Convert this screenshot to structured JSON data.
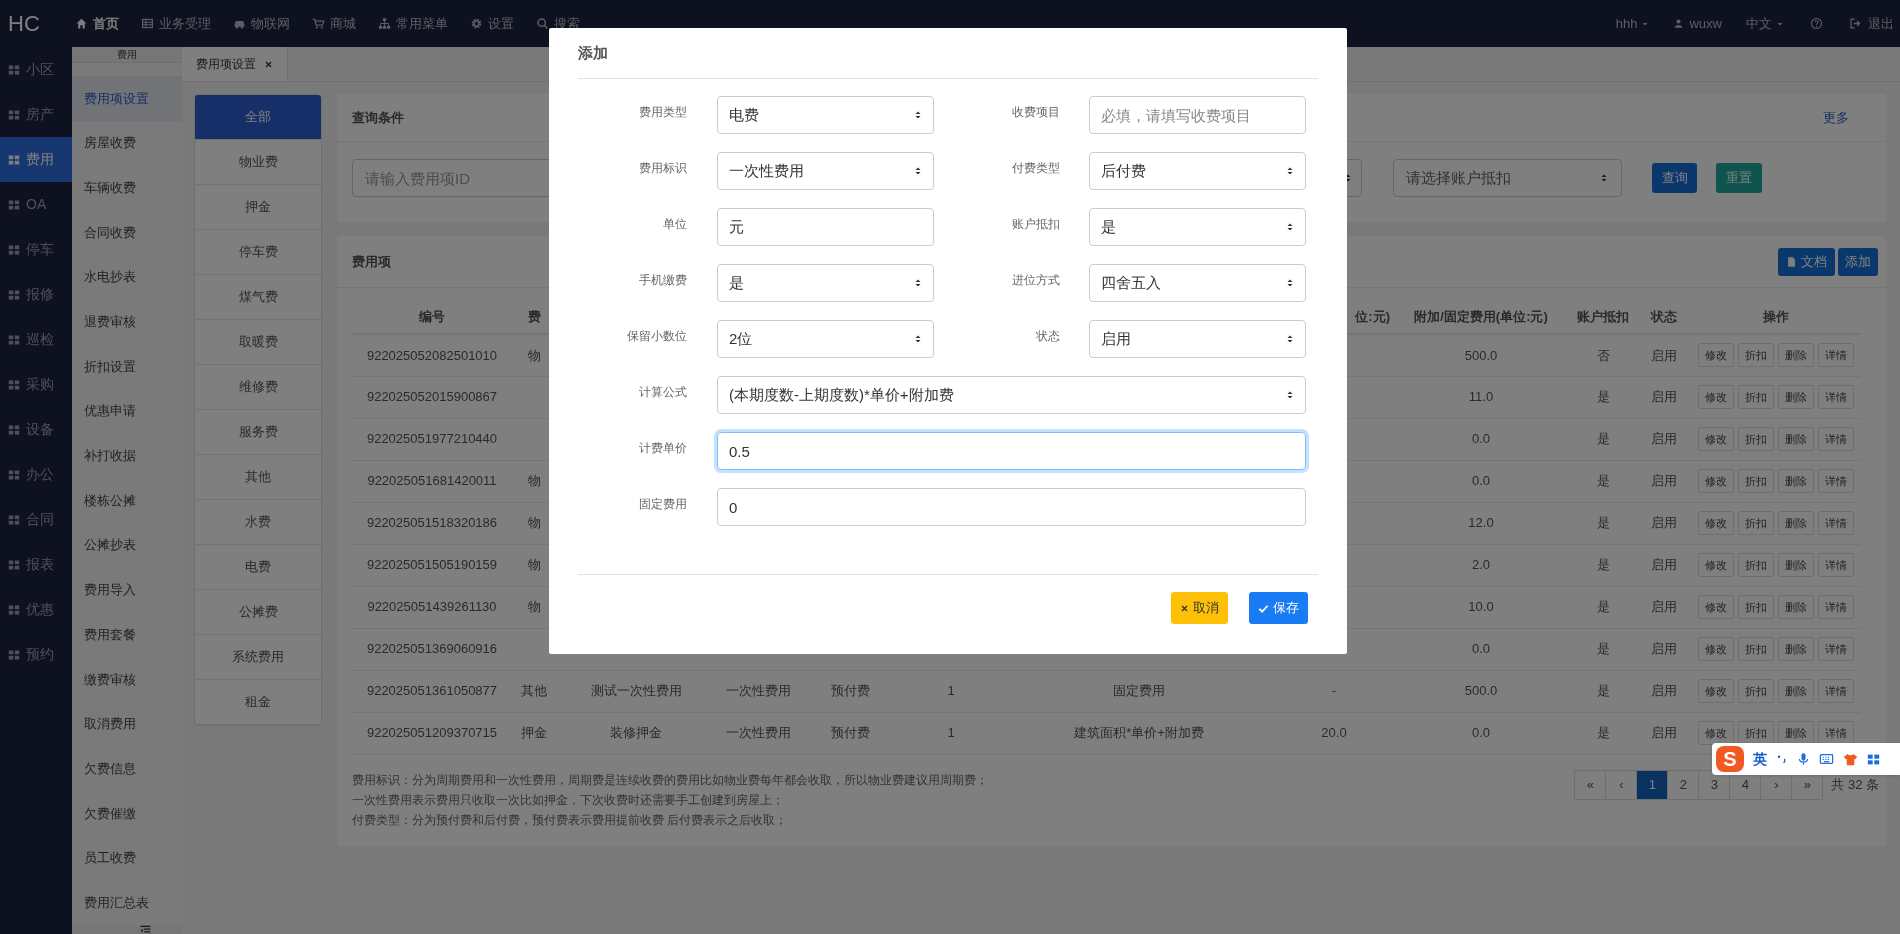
{
  "nav": {
    "logo": "HC",
    "items": [
      {
        "label": "首页",
        "selected": true
      },
      {
        "label": "业务受理",
        "selected": false
      },
      {
        "label": "物联网",
        "selected": false
      },
      {
        "label": "商城",
        "selected": false
      },
      {
        "label": "常用菜单",
        "selected": false
      },
      {
        "label": "设置",
        "selected": false
      },
      {
        "label": "搜索",
        "selected": false
      }
    ],
    "account": "hhh",
    "user": "wuxw",
    "language": "中文",
    "logout": "退出"
  },
  "sidebar": {
    "items": [
      {
        "label": "小区",
        "selected": false
      },
      {
        "label": "房产",
        "selected": false
      },
      {
        "label": "费用",
        "selected": true
      },
      {
        "label": "OA",
        "selected": false
      },
      {
        "label": "停车",
        "selected": false
      },
      {
        "label": "报修",
        "selected": false
      },
      {
        "label": "巡检",
        "selected": false
      },
      {
        "label": "采购",
        "selected": false
      },
      {
        "label": "设备",
        "selected": false
      },
      {
        "label": "办公",
        "selected": false
      },
      {
        "label": "合同",
        "selected": false
      },
      {
        "label": "报表",
        "selected": false
      },
      {
        "label": "优惠",
        "selected": false
      },
      {
        "label": "预约",
        "selected": false
      }
    ]
  },
  "submenu": {
    "title": "费用",
    "items": [
      {
        "label": "费用项设置",
        "selected": true
      },
      {
        "label": "房屋收费",
        "selected": false
      },
      {
        "label": "车辆收费",
        "selected": false
      },
      {
        "label": "合同收费",
        "selected": false
      },
      {
        "label": "水电抄表",
        "selected": false
      },
      {
        "label": "退费审核",
        "selected": false
      },
      {
        "label": "折扣设置",
        "selected": false
      },
      {
        "label": "优惠申请",
        "selected": false
      },
      {
        "label": "补打收据",
        "selected": false
      },
      {
        "label": "楼栋公摊",
        "selected": false
      },
      {
        "label": "公摊抄表",
        "selected": false
      },
      {
        "label": "费用导入",
        "selected": false
      },
      {
        "label": "费用套餐",
        "selected": false
      },
      {
        "label": "缴费审核",
        "selected": false
      },
      {
        "label": "取消费用",
        "selected": false
      },
      {
        "label": "欠费信息",
        "selected": false
      },
      {
        "label": "欠费催缴",
        "selected": false
      },
      {
        "label": "员工收费",
        "selected": false
      },
      {
        "label": "费用汇总表",
        "selected": false
      }
    ]
  },
  "tabs": [
    {
      "label": "费用项设置",
      "selected": true
    }
  ],
  "categories": [
    {
      "label": "全部",
      "selected": true
    },
    {
      "label": "物业费",
      "selected": false
    },
    {
      "label": "押金",
      "selected": false
    },
    {
      "label": "停车费",
      "selected": false
    },
    {
      "label": "煤气费",
      "selected": false
    },
    {
      "label": "取暖费",
      "selected": false
    },
    {
      "label": "维修费",
      "selected": false
    },
    {
      "label": "服务费",
      "selected": false
    },
    {
      "label": "其他",
      "selected": false
    },
    {
      "label": "水费",
      "selected": false
    },
    {
      "label": "电费",
      "selected": false
    },
    {
      "label": "公摊费",
      "selected": false
    },
    {
      "label": "系统费用",
      "selected": false
    },
    {
      "label": "租金",
      "selected": false
    }
  ],
  "query": {
    "title": "查询条件",
    "more": "更多",
    "id_placeholder": "请输入费用项ID",
    "deduct_placeholder": "请选择账户抵扣",
    "search_button": "查询",
    "reset_button": "重置"
  },
  "fee_table": {
    "title": "费用项",
    "doc_button": "文档",
    "add_button": "添加",
    "columns": {
      "id": "编号",
      "fee_type": "费",
      "unit_price": "位:元)",
      "fixed_fee": "附加/固定费用(单位:元)",
      "deduct": "账户抵扣",
      "status": "状态",
      "actions": "操作"
    },
    "rows": [
      {
        "id": "922025052082501010",
        "fee_type": "物",
        "fixed_fee": "500.0",
        "deduct": "否",
        "status": "启用",
        "actions": [
          "修改",
          "折扣",
          "删除",
          "详情"
        ]
      },
      {
        "id": "922025052015900867",
        "fixed_fee": "11.0",
        "deduct": "是",
        "status": "启用",
        "actions": [
          "修改",
          "折扣",
          "删除",
          "详情"
        ]
      },
      {
        "id": "922025051977210440",
        "fixed_fee": "0.0",
        "deduct": "是",
        "status": "启用",
        "actions": [
          "修改",
          "折扣",
          "删除",
          "详情"
        ]
      },
      {
        "id": "922025051681420011",
        "fee_type": "物",
        "fixed_fee": "0.0",
        "deduct": "是",
        "status": "启用",
        "actions": [
          "修改",
          "折扣",
          "删除",
          "详情"
        ]
      },
      {
        "id": "922025051518320186",
        "fee_type": "物",
        "fixed_fee": "12.0",
        "deduct": "是",
        "status": "启用",
        "actions": [
          "修改",
          "折扣",
          "删除",
          "详情"
        ]
      },
      {
        "id": "922025051505190159",
        "fee_type": "物",
        "fixed_fee": "2.0",
        "deduct": "是",
        "status": "启用",
        "actions": [
          "修改",
          "折扣",
          "删除",
          "详情"
        ]
      },
      {
        "id": "922025051439261130",
        "fee_type": "物",
        "fixed_fee": "10.0",
        "deduct": "是",
        "status": "启用",
        "actions": [
          "修改",
          "折扣",
          "删除",
          "详情"
        ]
      },
      {
        "id": "922025051369060916",
        "fixed_fee": "0.0",
        "deduct": "是",
        "status": "启用",
        "actions": [
          "修改",
          "折扣",
          "删除",
          "详情"
        ]
      },
      {
        "id": "922025051361050877",
        "fee_type": "其他",
        "item": "测试一次性费用",
        "flag": "一次性费用",
        "pay_type": "预付费",
        "cycle": "1",
        "formula": "固定费用",
        "unit_price": "-",
        "fixed_fee": "500.0",
        "deduct": "是",
        "status": "启用",
        "actions": [
          "修改",
          "折扣",
          "删除",
          "详情"
        ]
      },
      {
        "id": "922025051209370715",
        "fee_type": "押金",
        "item": "装修押金",
        "flag": "一次性费用",
        "pay_type": "预付费",
        "cycle": "1",
        "formula": "建筑面积*单价+附加费",
        "unit_price": "20.0",
        "fixed_fee": "0.0",
        "deduct": "是",
        "status": "启用",
        "actions": [
          "修改",
          "折扣",
          "删除",
          "详情"
        ]
      }
    ],
    "notes": [
      "费用标识：分为周期费用和一次性费用，周期费是连续收费的费用比如物业费每年都会收取，所以物业费建议用周期费；",
      "一次性费用表示费用只收取一次比如押金，下次收费时还需要手工创建到房屋上；",
      "付费类型：分为预付费和后付费，预付费表示费用提前收费 后付费表示之后收取；"
    ],
    "pagination": {
      "pages": [
        {
          "label": "«",
          "selected": false
        },
        {
          "label": "‹",
          "selected": false
        },
        {
          "label": "1",
          "selected": true
        },
        {
          "label": "2",
          "selected": false
        },
        {
          "label": "3",
          "selected": false
        },
        {
          "label": "4",
          "selected": false
        },
        {
          "label": "›",
          "selected": false
        },
        {
          "label": "»",
          "selected": false
        }
      ],
      "total": "共 32 条"
    }
  },
  "modal": {
    "title": "添加",
    "rows": [
      [
        {
          "label": "费用类型",
          "kind": "select",
          "value": "电费"
        },
        {
          "label": "收费项目",
          "kind": "input",
          "placeholder": "必填，请填写收费项目",
          "focused": false
        }
      ],
      [
        {
          "label": "费用标识",
          "kind": "select",
          "value": "一次性费用"
        },
        {
          "label": "付费类型",
          "kind": "select",
          "value": "后付费"
        }
      ],
      [
        {
          "label": "单位",
          "kind": "input",
          "value": "元",
          "focused": false
        },
        {
          "label": "账户抵扣",
          "kind": "select",
          "value": "是"
        }
      ],
      [
        {
          "label": "手机缴费",
          "kind": "select",
          "value": "是"
        },
        {
          "label": "进位方式",
          "kind": "select",
          "value": "四舍五入"
        }
      ],
      [
        {
          "label": "保留小数位",
          "kind": "select",
          "value": "2位"
        },
        {
          "label": "状态",
          "kind": "select",
          "value": "启用"
        }
      ],
      [
        {
          "label": "计算公式",
          "kind": "select",
          "value": "(本期度数-上期度数)*单价+附加费"
        }
      ],
      [
        {
          "label": "计费单价",
          "kind": "input",
          "value": "0.5",
          "focused": true
        }
      ],
      [
        {
          "label": "固定费用",
          "kind": "input",
          "value": "0",
          "focused": false
        }
      ]
    ],
    "cancel_button": "取消",
    "save_button": "保存"
  },
  "ime_toolbar": {
    "logo": "S",
    "mode": "英"
  }
}
